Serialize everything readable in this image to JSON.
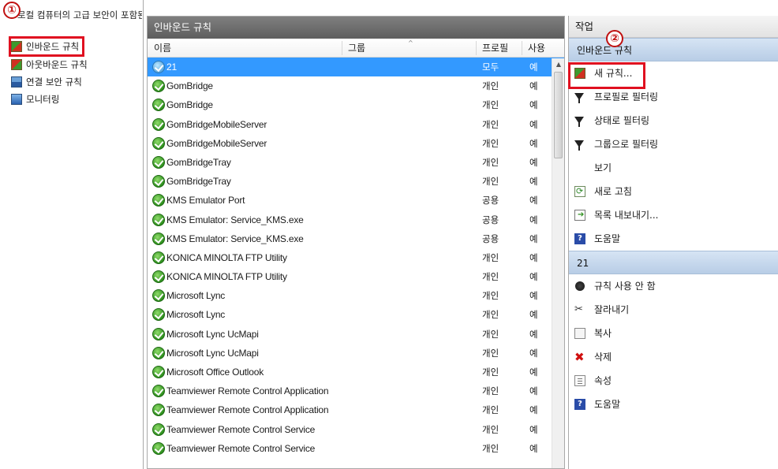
{
  "tree": {
    "root_label": "로컬 컴퓨터의 고급 보안이 포함된",
    "items": [
      {
        "label": "인바운드 규칙",
        "icon": "inbound-rules-icon"
      },
      {
        "label": "아웃바운드 규칙",
        "icon": "outbound-rules-icon"
      },
      {
        "label": "연결 보안 규칙",
        "icon": "connection-security-icon"
      },
      {
        "label": "모니터링",
        "icon": "monitoring-icon"
      }
    ]
  },
  "badges": {
    "first": "①",
    "second": "②"
  },
  "middle": {
    "title": "인바운드 규칙",
    "columns": {
      "name": "이름",
      "group": "그룹",
      "profile": "프로필",
      "enabled": "사용"
    },
    "rows": [
      {
        "name": "21",
        "profile": "모두",
        "enabled": "예",
        "selected": true
      },
      {
        "name": "GomBridge",
        "profile": "개인",
        "enabled": "예"
      },
      {
        "name": "GomBridge",
        "profile": "개인",
        "enabled": "예"
      },
      {
        "name": "GomBridgeMobileServer",
        "profile": "개인",
        "enabled": "예"
      },
      {
        "name": "GomBridgeMobileServer",
        "profile": "개인",
        "enabled": "예"
      },
      {
        "name": "GomBridgeTray",
        "profile": "개인",
        "enabled": "예"
      },
      {
        "name": "GomBridgeTray",
        "profile": "개인",
        "enabled": "예"
      },
      {
        "name": "KMS Emulator Port",
        "profile": "공용",
        "enabled": "예"
      },
      {
        "name": "KMS Emulator: Service_KMS.exe",
        "profile": "공용",
        "enabled": "예"
      },
      {
        "name": "KMS Emulator: Service_KMS.exe",
        "profile": "공용",
        "enabled": "예"
      },
      {
        "name": "KONICA MINOLTA FTP Utility",
        "profile": "개인",
        "enabled": "예"
      },
      {
        "name": "KONICA MINOLTA FTP Utility",
        "profile": "개인",
        "enabled": "예"
      },
      {
        "name": "Microsoft Lync",
        "profile": "개인",
        "enabled": "예"
      },
      {
        "name": "Microsoft Lync",
        "profile": "개인",
        "enabled": "예"
      },
      {
        "name": "Microsoft Lync UcMapi",
        "profile": "개인",
        "enabled": "예"
      },
      {
        "name": "Microsoft Lync UcMapi",
        "profile": "개인",
        "enabled": "예"
      },
      {
        "name": "Microsoft Office Outlook",
        "profile": "개인",
        "enabled": "예"
      },
      {
        "name": "Teamviewer Remote Control Application",
        "profile": "개인",
        "enabled": "예"
      },
      {
        "name": "Teamviewer Remote Control Application",
        "profile": "개인",
        "enabled": "예"
      },
      {
        "name": "Teamviewer Remote Control Service",
        "profile": "개인",
        "enabled": "예"
      },
      {
        "name": "Teamviewer Remote Control Service",
        "profile": "개인",
        "enabled": "예"
      }
    ]
  },
  "actions": {
    "title": "작업",
    "section1": {
      "header": "인바운드 규칙",
      "items": [
        {
          "label": "새 규칙...",
          "icon": "new-rule-icon"
        },
        {
          "label": "프로필로 필터링",
          "icon": "filter-icon"
        },
        {
          "label": "상태로 필터링",
          "icon": "filter-icon"
        },
        {
          "label": "그룹으로 필터링",
          "icon": "filter-icon"
        },
        {
          "label": "보기",
          "icon": ""
        },
        {
          "label": "새로 고침",
          "icon": "refresh-icon"
        },
        {
          "label": "목록 내보내기...",
          "icon": "export-icon"
        },
        {
          "label": "도움말",
          "icon": "help-icon"
        }
      ]
    },
    "section2": {
      "header": "21",
      "items": [
        {
          "label": "규칙 사용 안 함",
          "icon": "disable-icon"
        },
        {
          "label": "잘라내기",
          "icon": "cut-icon"
        },
        {
          "label": "복사",
          "icon": "copy-icon"
        },
        {
          "label": "삭제",
          "icon": "delete-icon"
        },
        {
          "label": "속성",
          "icon": "properties-icon"
        },
        {
          "label": "도움말",
          "icon": "help-icon"
        }
      ]
    }
  },
  "colors": {
    "selection": "#3399ff",
    "highlight_box": "#e01020",
    "annotation": "#c01010"
  }
}
